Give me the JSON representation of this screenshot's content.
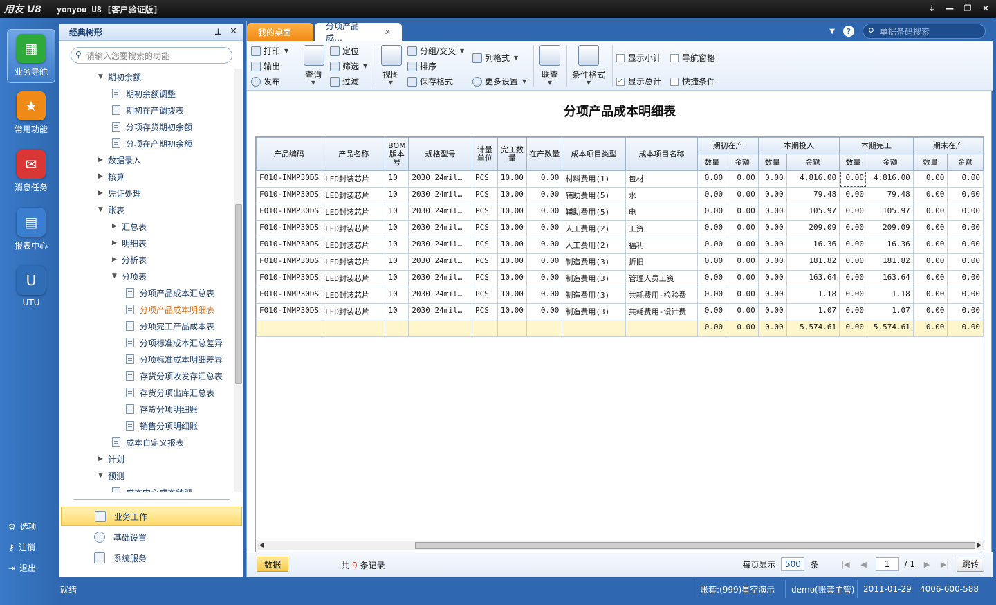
{
  "app": {
    "logo": "用友 U8",
    "title": "yonyou U8 [客户验证版]",
    "controls": [
      "⇣",
      "—",
      "❐",
      "✕"
    ]
  },
  "rail": {
    "items": [
      {
        "label": "业务导航",
        "icon": "tree-nav-icon",
        "color": "#2eaa3a"
      },
      {
        "label": "常用功能",
        "icon": "star-icon",
        "color": "#f08a16"
      },
      {
        "label": "消息任务",
        "icon": "mail-icon",
        "color": "#d93636"
      },
      {
        "label": "报表中心",
        "icon": "report-icon",
        "color": "#3b7ed0"
      },
      {
        "label": "UTU",
        "icon": "utu-icon",
        "color": "#2f6db6"
      }
    ],
    "bottom": [
      {
        "label": "选项",
        "icon": "gear-icon"
      },
      {
        "label": "注销",
        "icon": "key-icon"
      },
      {
        "label": "退出",
        "icon": "exit-icon"
      }
    ]
  },
  "tree": {
    "title": "经典树形",
    "search_placeholder": "请输入您要搜索的功能",
    "rows": [
      {
        "label": "期初余额",
        "level": 0,
        "type": "open"
      },
      {
        "label": "期初余额调整",
        "level": 1,
        "type": "doc"
      },
      {
        "label": "期初在产调拨表",
        "level": 1,
        "type": "doc"
      },
      {
        "label": "分项存货期初余额",
        "level": 1,
        "type": "doc"
      },
      {
        "label": "分项在产期初余额",
        "level": 1,
        "type": "doc"
      },
      {
        "label": "数据录入",
        "level": 0,
        "type": "closed"
      },
      {
        "label": "核算",
        "level": 0,
        "type": "closed"
      },
      {
        "label": "凭证处理",
        "level": 0,
        "type": "closed"
      },
      {
        "label": "账表",
        "level": 0,
        "type": "open"
      },
      {
        "label": "汇总表",
        "level": 1,
        "type": "closed"
      },
      {
        "label": "明细表",
        "level": 1,
        "type": "closed"
      },
      {
        "label": "分析表",
        "level": 1,
        "type": "closed"
      },
      {
        "label": "分项表",
        "level": 1,
        "type": "open"
      },
      {
        "label": "分项产品成本汇总表",
        "level": 2,
        "type": "doc"
      },
      {
        "label": "分项产品成本明细表",
        "level": 2,
        "type": "doc",
        "selected": true
      },
      {
        "label": "分项完工产品成本表",
        "level": 2,
        "type": "doc"
      },
      {
        "label": "分项标准成本汇总差异",
        "level": 2,
        "type": "doc"
      },
      {
        "label": "分项标准成本明细差异",
        "level": 2,
        "type": "doc"
      },
      {
        "label": "存货分项收发存汇总表",
        "level": 2,
        "type": "doc"
      },
      {
        "label": "存货分项出库汇总表",
        "level": 2,
        "type": "doc"
      },
      {
        "label": "存货分项明细账",
        "level": 2,
        "type": "doc"
      },
      {
        "label": "销售分项明细账",
        "level": 2,
        "type": "doc"
      },
      {
        "label": "成本自定义报表",
        "level": 1,
        "type": "doc"
      },
      {
        "label": "计划",
        "level": 0,
        "type": "closed"
      },
      {
        "label": "预测",
        "level": 0,
        "type": "open"
      },
      {
        "label": "成本中心成本预测",
        "level": 1,
        "type": "doc"
      }
    ],
    "nav": [
      {
        "label": "业务工作",
        "active": true
      },
      {
        "label": "基础设置",
        "active": false
      },
      {
        "label": "系统服务",
        "active": false
      }
    ]
  },
  "tabs": {
    "home": "我的桌面",
    "active": "分项产品成…",
    "barcode_placeholder": "单据条码搜索"
  },
  "ribbon": {
    "print": "打印",
    "output": "输出",
    "publish": "发布",
    "query": "查询",
    "locate": "定位",
    "filter": "筛选",
    "filter2": "过滤",
    "view": "视图",
    "group": "分组/交叉",
    "sort": "排序",
    "save_format": "保存格式",
    "col_format": "列格式",
    "more_settings": "更多设置",
    "link_query": "联查",
    "cond_format": "条件格式",
    "show_subtotal": "显示小计",
    "nav_window": "导航窗格",
    "show_total": "显示总计",
    "quick_cond": "快捷条件"
  },
  "report": {
    "title": "分项产品成本明细表",
    "headers": {
      "code": "产品编码",
      "name": "产品名称",
      "bom": "BOM版本号",
      "spec": "规格型号",
      "unit": "计量单位",
      "done_qty": "完工数量",
      "wip_qty": "在产数量",
      "cost_type": "成本项目类型",
      "cost_name": "成本项目名称",
      "g1": "期初在产",
      "g2": "本期投入",
      "g3": "本期完工",
      "g4": "期末在产",
      "qty": "数量",
      "amt": "金额"
    },
    "rows": [
      [
        "F010-INMP30DS",
        "LED封装芯片",
        "10",
        "2030 24mil…",
        "PCS",
        "10.00",
        "0.00",
        "材料费用(1)",
        "包材",
        "0.00",
        "0.00",
        "0.00",
        "4,816.00",
        "0.00",
        "4,816.00",
        "0.00",
        "0.00"
      ],
      [
        "F010-INMP30DS",
        "LED封装芯片",
        "10",
        "2030 24mil…",
        "PCS",
        "10.00",
        "0.00",
        "辅助费用(5)",
        "水",
        "0.00",
        "0.00",
        "0.00",
        "79.48",
        "0.00",
        "79.48",
        "0.00",
        "0.00"
      ],
      [
        "F010-INMP30DS",
        "LED封装芯片",
        "10",
        "2030 24mil…",
        "PCS",
        "10.00",
        "0.00",
        "辅助费用(5)",
        "电",
        "0.00",
        "0.00",
        "0.00",
        "105.97",
        "0.00",
        "105.97",
        "0.00",
        "0.00"
      ],
      [
        "F010-INMP30DS",
        "LED封装芯片",
        "10",
        "2030 24mil…",
        "PCS",
        "10.00",
        "0.00",
        "人工费用(2)",
        "工资",
        "0.00",
        "0.00",
        "0.00",
        "209.09",
        "0.00",
        "209.09",
        "0.00",
        "0.00"
      ],
      [
        "F010-INMP30DS",
        "LED封装芯片",
        "10",
        "2030 24mil…",
        "PCS",
        "10.00",
        "0.00",
        "人工费用(2)",
        "福利",
        "0.00",
        "0.00",
        "0.00",
        "16.36",
        "0.00",
        "16.36",
        "0.00",
        "0.00"
      ],
      [
        "F010-INMP30DS",
        "LED封装芯片",
        "10",
        "2030 24mil…",
        "PCS",
        "10.00",
        "0.00",
        "制造费用(3)",
        "折旧",
        "0.00",
        "0.00",
        "0.00",
        "181.82",
        "0.00",
        "181.82",
        "0.00",
        "0.00"
      ],
      [
        "F010-INMP30DS",
        "LED封装芯片",
        "10",
        "2030 24mil…",
        "PCS",
        "10.00",
        "0.00",
        "制造费用(3)",
        "管理人员工资",
        "0.00",
        "0.00",
        "0.00",
        "163.64",
        "0.00",
        "163.64",
        "0.00",
        "0.00"
      ],
      [
        "F010-INMP30DS",
        "LED封装芯片",
        "10",
        "2030 24mil…",
        "PCS",
        "10.00",
        "0.00",
        "制造费用(3)",
        "共耗费用-检验费",
        "0.00",
        "0.00",
        "0.00",
        "1.18",
        "0.00",
        "1.18",
        "0.00",
        "0.00"
      ],
      [
        "F010-INMP30DS",
        "LED封装芯片",
        "10",
        "2030 24mil…",
        "PCS",
        "10.00",
        "0.00",
        "制造费用(3)",
        "共耗费用-设计费",
        "0.00",
        "0.00",
        "0.00",
        "1.07",
        "0.00",
        "1.07",
        "0.00",
        "0.00"
      ]
    ],
    "total": [
      "0.00",
      "0.00",
      "0.00",
      "5,574.61",
      "0.00",
      "5,574.61",
      "0.00",
      "0.00"
    ]
  },
  "footer": {
    "data_btn": "数据",
    "rec_prefix": "共",
    "rec_count": "9",
    "rec_suffix": "条记录",
    "per_page_label": "每页显示",
    "per_page": "500",
    "per_page_unit": "条",
    "page": "1",
    "page_total": "/ 1",
    "jump": "跳转"
  },
  "status": {
    "ready": "就绪",
    "account": "账套:(999)星空演示",
    "user": "demo(账套主管)",
    "date": "2011-01-29",
    "phone": "4006-600-588"
  }
}
